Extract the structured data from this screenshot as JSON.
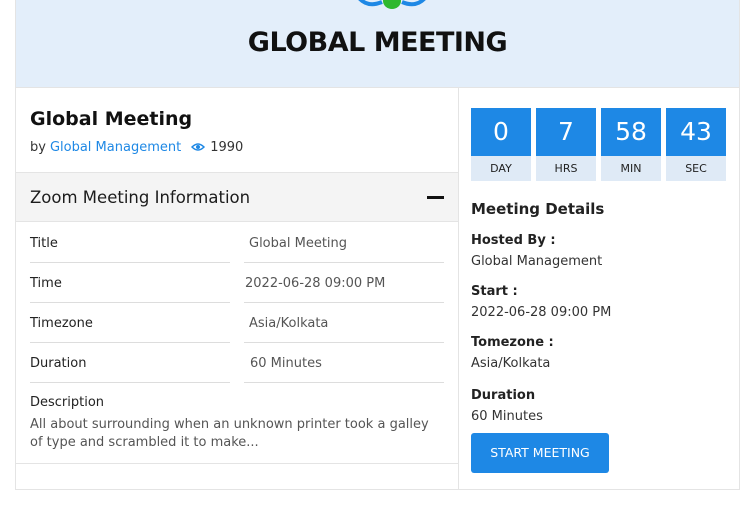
{
  "banner": {
    "title": "GLOBAL MEETING",
    "logo_colors": {
      "wings": "#1e88e5",
      "center": "#2eb82e"
    }
  },
  "meeting": {
    "title": "Global Meeting",
    "by_prefix": "by",
    "host": "Global Management",
    "views": "1990",
    "icons": {
      "views": "eye-icon",
      "collapse": "minus-icon"
    }
  },
  "zoom_info": {
    "heading": "Zoom Meeting Information",
    "rows": [
      {
        "label": "Title",
        "value": "Global Meeting"
      },
      {
        "label": "Time",
        "value": "2022-06-28 09:00 PM"
      },
      {
        "label": "Timezone",
        "value": "Asia/Kolkata"
      },
      {
        "label": "Duration",
        "value": "60 Minutes"
      }
    ],
    "description_label": "Description",
    "description_text": "All about surrounding when an unknown printer took a galley of type and scrambled it to make..."
  },
  "countdown": [
    {
      "value": "0",
      "unit": "DAY"
    },
    {
      "value": "7",
      "unit": "HRS"
    },
    {
      "value": "58",
      "unit": "MIN"
    },
    {
      "value": "43",
      "unit": "SEC"
    }
  ],
  "details": {
    "heading": "Meeting Details",
    "hosted_by_label": "Hosted By :",
    "hosted_by": "Global Management",
    "start_label": "Start :",
    "start": "2022-06-28 09:00 PM",
    "timezone_label": "Tomezone :",
    "timezone": "Asia/Kolkata",
    "duration_label": "Duration",
    "duration": "60 Minutes"
  },
  "actions": {
    "start_meeting": "START MEETING"
  },
  "colors": {
    "accent": "#1e88e5",
    "banner_bg": "#e3eefa"
  }
}
